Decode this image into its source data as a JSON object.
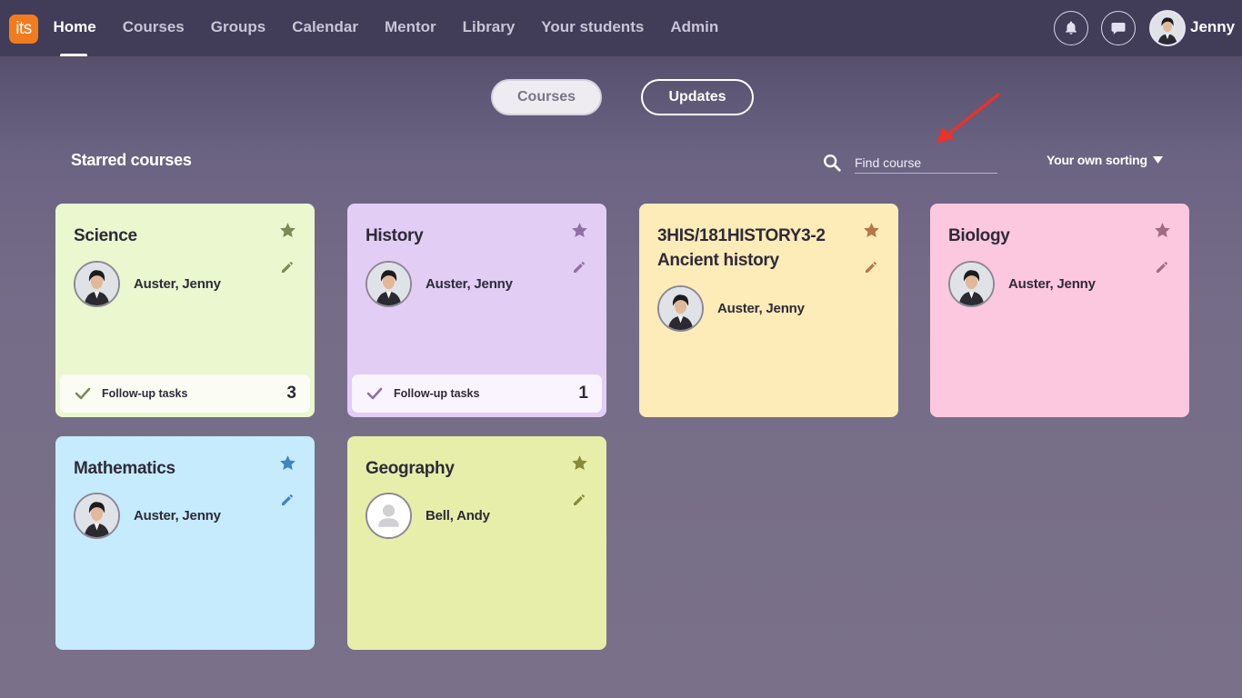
{
  "app": {
    "logo_text": "its"
  },
  "nav": {
    "items": [
      {
        "label": "Home",
        "active": true
      },
      {
        "label": "Courses"
      },
      {
        "label": "Groups"
      },
      {
        "label": "Calendar"
      },
      {
        "label": "Mentor"
      },
      {
        "label": "Library"
      },
      {
        "label": "Your students"
      },
      {
        "label": "Admin"
      }
    ]
  },
  "user": {
    "name": "Jenny"
  },
  "toggle": {
    "courses_label": "Courses",
    "updates_label": "Updates"
  },
  "section": {
    "title": "Starred courses"
  },
  "search": {
    "placeholder": "Find course"
  },
  "sorting": {
    "label": "Your own sorting"
  },
  "cards": [
    {
      "title": "Science",
      "teacher": "Auster, Jenny",
      "followup_label": "Follow-up tasks",
      "followup_count": "3",
      "color": "#eaf7cf",
      "accent": "#7c8a56"
    },
    {
      "title": "History",
      "teacher": "Auster, Jenny",
      "followup_label": "Follow-up tasks",
      "followup_count": "1",
      "color": "#e2cdf4",
      "accent": "#8f6fa6"
    },
    {
      "title": "3HIS/181HISTORY3-2 Ancient history",
      "teacher": "Auster, Jenny",
      "color": "#fdebb8",
      "accent": "#b4764a"
    },
    {
      "title": "Biology",
      "teacher": "Auster, Jenny",
      "color": "#fcc8df",
      "accent": "#a26b83"
    },
    {
      "title": "Mathematics",
      "teacher": "Auster, Jenny",
      "color": "#c5ebfc",
      "accent": "#3b86c3"
    },
    {
      "title": "Geography",
      "teacher": "Bell, Andy",
      "color": "#e6eeaa",
      "accent": "#878a3d"
    }
  ]
}
